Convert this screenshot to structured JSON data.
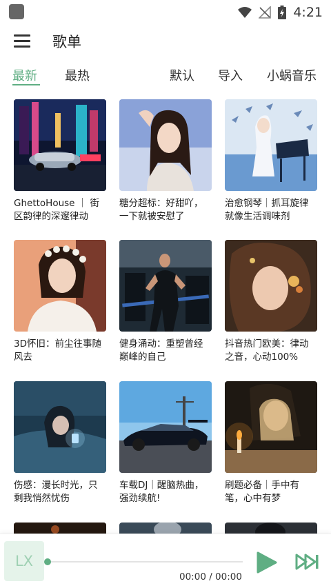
{
  "status_bar": {
    "time": "4:21"
  },
  "header": {
    "title": "歌单"
  },
  "tabs": {
    "latest": "最新",
    "hottest": "最热",
    "default": "默认",
    "import": "导入",
    "source": "小蜗音乐"
  },
  "accent_color": "#5fae83",
  "playlists": [
    {
      "title": "GhettoHouse ｜ 街区韵律的深邃律动"
    },
    {
      "title": "糖分超标：好甜吖，一下就被安慰了"
    },
    {
      "title": "治愈钢琴｜抓耳旋律就像生活调味剂"
    },
    {
      "title": "3D怀旧：前尘往事随风去"
    },
    {
      "title": "健身涌动：重塑曾经巅峰的自己"
    },
    {
      "title": "抖音热门欧美：律动之音，心动100%"
    },
    {
      "title": "伤感：漫长时光，只剩我悄然忧伤"
    },
    {
      "title": "车载DJ｜醒脑热曲，强劲续航!"
    },
    {
      "title": "刷题必备｜手中有笔，心中有梦"
    }
  ],
  "player": {
    "logo": "LX",
    "time": "00:00 / 00:00",
    "progress": 0
  }
}
